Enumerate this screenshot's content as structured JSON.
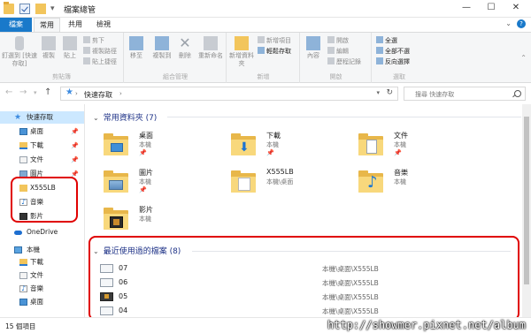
{
  "window": {
    "title": "檔案總管",
    "buttons": {
      "minimize": "—",
      "maximize": "☐",
      "close": "✕"
    }
  },
  "tabs": [
    {
      "label": "檔案"
    },
    {
      "label": "常用"
    },
    {
      "label": "共用"
    },
    {
      "label": "檢視"
    }
  ],
  "ribbon": {
    "clipboard": {
      "label": "剪貼簿",
      "pin": "釘選到 [快速存取]",
      "copy": "複製",
      "paste": "貼上",
      "cut": "剪下",
      "copy_path": "複製路徑",
      "paste_shortcut": "貼上捷徑"
    },
    "organize": {
      "label": "組合管理",
      "move": "移至",
      "copy": "複製到",
      "delete": "刪除",
      "rename": "重新命名"
    },
    "new": {
      "label": "新增",
      "new_folder": "新增資料夾",
      "new_item": "新增項目",
      "easy_access": "輕鬆存取"
    },
    "open": {
      "label": "開啟",
      "properties": "內容",
      "open": "開啟",
      "edit": "編輯",
      "history": "歷程記錄"
    },
    "select": {
      "label": "選取",
      "select_all": "全選",
      "select_none": "全部不選",
      "invert": "反向選擇"
    }
  },
  "address": {
    "location": "快速存取",
    "search_placeholder": "搜尋 快速存取"
  },
  "sidebar": {
    "quick_access": "快速存取",
    "items": [
      {
        "label": "桌面",
        "icon": "desktop-icon",
        "pinned": true
      },
      {
        "label": "下載",
        "icon": "download-icon",
        "pinned": true
      },
      {
        "label": "文件",
        "icon": "document-icon",
        "pinned": true
      },
      {
        "label": "圖片",
        "icon": "picture-icon",
        "pinned": true
      },
      {
        "label": "X555LB",
        "icon": "folder-icon",
        "pinned": false
      },
      {
        "label": "音樂",
        "icon": "music-icon",
        "pinned": false
      },
      {
        "label": "影片",
        "icon": "video-icon",
        "pinned": false
      }
    ],
    "onedrive": "OneDrive",
    "this_pc": "本機",
    "pc_items": [
      {
        "label": "下載"
      },
      {
        "label": "文件"
      },
      {
        "label": "音樂"
      },
      {
        "label": "桌面"
      }
    ]
  },
  "frequent": {
    "header": "常用資料夾 (7)",
    "folders": [
      {
        "name": "桌面",
        "sub": "本機",
        "pinned": true,
        "badge": "desktop"
      },
      {
        "name": "下載",
        "sub": "本機",
        "pinned": true,
        "badge": "download"
      },
      {
        "name": "文件",
        "sub": "本機",
        "pinned": true,
        "badge": "document"
      },
      {
        "name": "圖片",
        "sub": "本機",
        "pinned": true,
        "badge": "picture"
      },
      {
        "name": "X555LB",
        "sub": "本機\\桌面",
        "pinned": false,
        "badge": "docs"
      },
      {
        "name": "音樂",
        "sub": "本機",
        "pinned": false,
        "badge": "music"
      },
      {
        "name": "影片",
        "sub": "本機",
        "pinned": false,
        "badge": "video"
      }
    ]
  },
  "recent": {
    "header": "最近使用過的檔案 (8)",
    "files": [
      {
        "name": "07",
        "path": "本機\\桌面\\X555LB"
      },
      {
        "name": "06",
        "path": "本機\\桌面\\X555LB"
      },
      {
        "name": "05",
        "path": "本機\\桌面\\X555LB"
      },
      {
        "name": "04",
        "path": "本機\\桌面\\X555LB"
      }
    ]
  },
  "status": {
    "count": "15 個項目",
    "watermark": "http://showmer.pixnet.net/album"
  },
  "colors": {
    "accent": "#1979ca",
    "highlight": "#e00000",
    "section_header": "#1e3287"
  }
}
